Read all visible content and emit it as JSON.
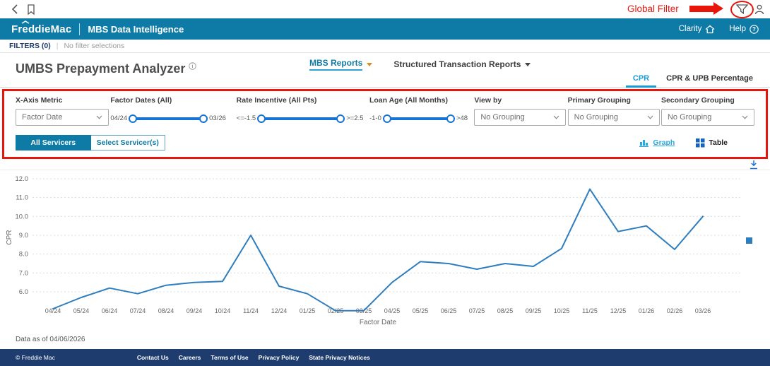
{
  "utility_bar": {
    "global_filter_annotation": "Global Filter"
  },
  "header": {
    "logo_text": "FreddieMac",
    "app_title": "MBS Data Intelligence",
    "clarity_label": "Clarity",
    "help_label": "Help"
  },
  "filter_status_bar": {
    "filters_count_label": "FILTERS (0)",
    "separator": "|",
    "selection_text": "No filter selections"
  },
  "page": {
    "title": "UMBS Prepayment Analyzer",
    "reports_nav": {
      "mbs_reports_label": "MBS Reports",
      "structured_reports_label": "Structured Transaction Reports"
    },
    "tabs": [
      {
        "label": "CPR"
      },
      {
        "label": "CPR & UPB Percentage"
      }
    ]
  },
  "filter_panel": {
    "x_axis_metric": {
      "label": "X-Axis Metric",
      "value": "Factor Date"
    },
    "factor_dates": {
      "label": "Factor Dates (All)",
      "min_label": "04/24",
      "max_label": "03/26"
    },
    "rate_incentive": {
      "label": "Rate Incentive (All Pts)",
      "min_label": "<=-1.5",
      "max_label": ">=2.5"
    },
    "loan_age": {
      "label": "Loan Age (All Months)",
      "min_label": "-1-0",
      "max_label": ">48"
    },
    "view_by": {
      "label": "View by",
      "value": "No Grouping"
    },
    "primary_grouping": {
      "label": "Primary Grouping",
      "value": "No Grouping"
    },
    "secondary_grouping": {
      "label": "Secondary Grouping",
      "value": "No Grouping"
    },
    "servicer_buttons": {
      "all_label": "All Servicers",
      "select_label": "Select Servicer(s)"
    },
    "view_toggle": {
      "graph_label": "Graph",
      "table_label": "Table"
    }
  },
  "chart_data": {
    "type": "line",
    "title": "",
    "xlabel": "Factor Date",
    "ylabel": "CPR",
    "x": [
      "04/24",
      "05/24",
      "06/24",
      "07/24",
      "08/24",
      "09/24",
      "10/24",
      "11/24",
      "12/24",
      "01/25",
      "02/25",
      "03/25",
      "04/25",
      "05/25",
      "06/25",
      "07/25",
      "08/25",
      "09/25",
      "10/25",
      "11/25",
      "12/25",
      "01/26",
      "02/26",
      "03/26"
    ],
    "series": [
      {
        "name": "CPR",
        "values": [
          5.1,
          5.7,
          6.2,
          5.9,
          6.35,
          6.5,
          6.55,
          9.0,
          6.3,
          5.9,
          5.0,
          5.0,
          6.5,
          7.6,
          7.5,
          7.2,
          7.5,
          7.35,
          8.3,
          11.45,
          9.2,
          9.5,
          8.25,
          10.0
        ]
      }
    ],
    "yticks": [
      6,
      7,
      8,
      9,
      10,
      11,
      12
    ],
    "ylim": [
      4.5,
      12.3
    ],
    "grid": "dashed-horizontal",
    "legend_position": "right-square-marker",
    "line_color": "#2e7dbe"
  },
  "footnote": "Data as of 04/06/2026",
  "footer": {
    "copyright": "© Freddie Mac",
    "links": [
      "Contact Us",
      "Careers",
      "Terms of Use",
      "Privacy Policy",
      "State Privacy Notices"
    ]
  },
  "colors": {
    "header_teal": "#0d7ba6",
    "tab_active_blue": "#189bd7",
    "slider_blue": "#1874d2",
    "chart_line_blue": "#2e7dbe",
    "footer_navy": "#1e3c6e",
    "annotation_red": "#e8150b"
  }
}
